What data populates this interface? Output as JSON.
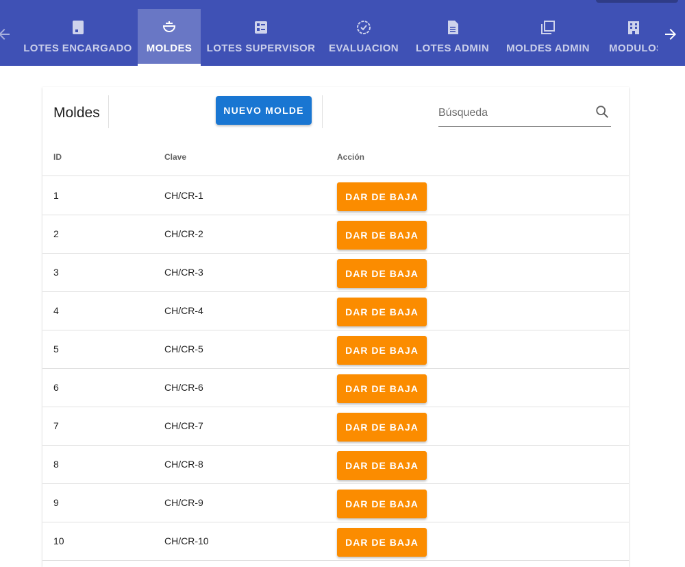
{
  "nav": {
    "tabs": [
      {
        "label": "LOTES ENCARGADO",
        "icon": "sd-card-icon",
        "active": false
      },
      {
        "label": "MOLDES",
        "icon": "bowl-icon",
        "active": true
      },
      {
        "label": "LOTES SUPERVISOR",
        "icon": "checklist-icon",
        "active": false
      },
      {
        "label": "EVALUACION",
        "icon": "verified-badge-icon",
        "active": false
      },
      {
        "label": "LOTES ADMIN",
        "icon": "document-icon",
        "active": false
      },
      {
        "label": "MOLDES ADMIN",
        "icon": "copy-icon",
        "active": false
      },
      {
        "label": "MODULOS",
        "icon": "building-icon",
        "active": false
      }
    ],
    "scroll_left_icon": "arrow-left-icon",
    "scroll_right_icon": "arrow-right-icon"
  },
  "panel": {
    "title": "Moldes",
    "new_button_label": "NUEVO MOLDE",
    "search_placeholder": "Búsqueda",
    "search_icon": "search-icon"
  },
  "table": {
    "headers": {
      "id": "ID",
      "clave": "Clave",
      "accion": "Acción"
    },
    "rows": [
      {
        "id": "1",
        "clave": "CH/CR-1",
        "action_label": "DAR DE BAJA"
      },
      {
        "id": "2",
        "clave": "CH/CR-2",
        "action_label": "DAR DE BAJA"
      },
      {
        "id": "3",
        "clave": "CH/CR-3",
        "action_label": "DAR DE BAJA"
      },
      {
        "id": "4",
        "clave": "CH/CR-4",
        "action_label": "DAR DE BAJA"
      },
      {
        "id": "5",
        "clave": "CH/CR-5",
        "action_label": "DAR DE BAJA"
      },
      {
        "id": "6",
        "clave": "CH/CR-6",
        "action_label": "DAR DE BAJA"
      },
      {
        "id": "7",
        "clave": "CH/CR-7",
        "action_label": "DAR DE BAJA"
      },
      {
        "id": "8",
        "clave": "CH/CR-8",
        "action_label": "DAR DE BAJA"
      },
      {
        "id": "9",
        "clave": "CH/CR-9",
        "action_label": "DAR DE BAJA"
      },
      {
        "id": "10",
        "clave": "CH/CR-10",
        "action_label": "DAR DE BAJA"
      }
    ]
  },
  "colors": {
    "nav_background": "#3f51b5",
    "primary_button": "#1976d2",
    "action_button": "#fb8c00"
  }
}
